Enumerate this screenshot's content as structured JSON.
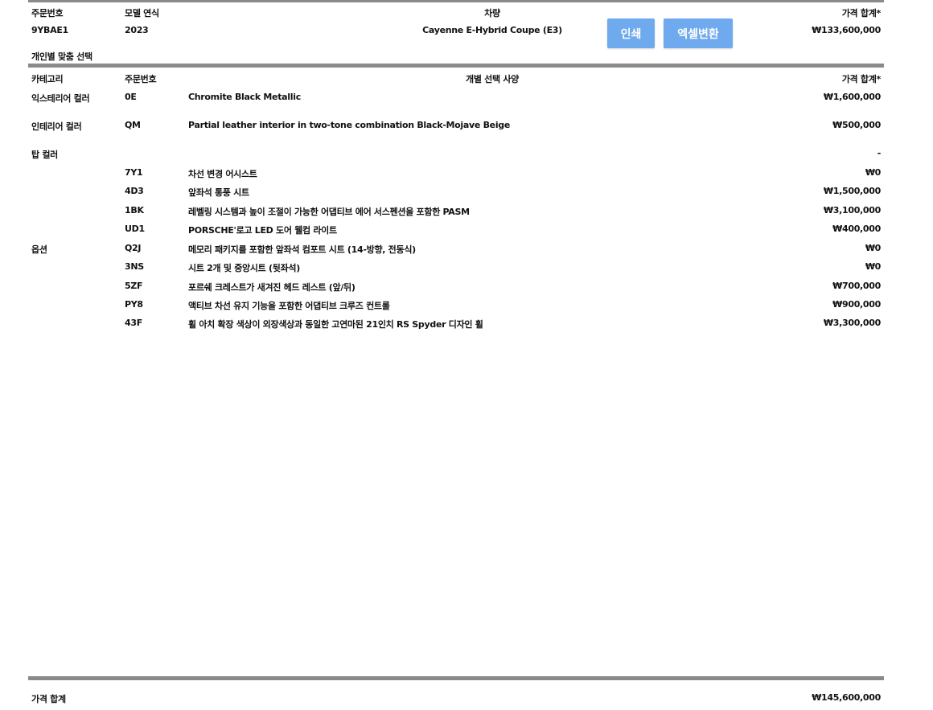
{
  "summary": {
    "headers": {
      "order_no": "주문번호",
      "model_year": "모델 연식",
      "vehicle": "차량",
      "price_total": "가격 합계*"
    },
    "order_no": "9YBAE1",
    "model_year": "2023",
    "vehicle": "Cayenne E-Hybrid Coupe (E3)",
    "price_total": "₩133,600,000"
  },
  "buttons": {
    "print": "인쇄",
    "excel": "엑셀변환"
  },
  "section_title": "개인별 맞춤 선택",
  "options_table": {
    "headers": {
      "category": "카테고리",
      "order_no": "주문번호",
      "option": "개별 선택 사양",
      "price": "가격 합계*"
    },
    "rows": [
      {
        "category": "익스테리어 컬러",
        "code": "0E",
        "desc": "Chromite Black Metallic",
        "price": "₩1,600,000"
      },
      {
        "category": "인테리어 컬러",
        "code": "QM",
        "desc": "Partial leather interior in two-tone combination Black-Mojave Beige",
        "price": "₩500,000"
      },
      {
        "category": "탑 컬러",
        "code": "",
        "desc": "",
        "price": "-"
      },
      {
        "category": "",
        "code": "7Y1",
        "desc": "차선 변경 어시스트",
        "price": "₩0"
      },
      {
        "category": "",
        "code": "4D3",
        "desc": "앞좌석 통풍 시트",
        "price": "₩1,500,000"
      },
      {
        "category": "",
        "code": "1BK",
        "desc": "레벨링 시스템과 높이 조절이 가능한 어댑티브 에어 서스펜션을 포함한 PASM",
        "price": "₩3,100,000"
      },
      {
        "category": "",
        "code": "UD1",
        "desc": "PORSCHE'로고 LED 도어 웰컴 라이트",
        "price": "₩400,000"
      },
      {
        "category": "옵션",
        "code": "Q2J",
        "desc": "메모리 패키지를 포함한 앞좌석 컴포트 시트 (14-방향, 전동식)",
        "price": "₩0"
      },
      {
        "category": "",
        "code": "3NS",
        "desc": "시트 2개 및 중앙시트 (뒷좌석)",
        "price": "₩0"
      },
      {
        "category": "",
        "code": "5ZF",
        "desc": "포르쉐 크레스트가 새겨진 헤드 레스트 (앞/뒤)",
        "price": "₩700,000"
      },
      {
        "category": "",
        "code": "PY8",
        "desc": "액티브 차선 유지 기능을 포함한 어댑티브 크루즈 컨트롤",
        "price": "₩900,000"
      },
      {
        "category": "",
        "code": "43F",
        "desc": "휠 아치 확장 색상이 외장색상과 동일한 고연마된 21인치 RS Spyder 디자인 휠",
        "price": "₩3,300,000"
      }
    ]
  },
  "footer": {
    "label": "가격 합계",
    "total": "₩145,600,000"
  }
}
